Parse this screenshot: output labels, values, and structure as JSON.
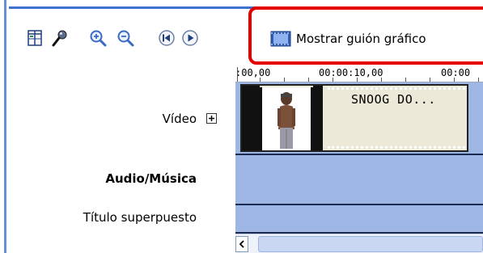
{
  "toolbar": {
    "storyboard_label": "Mostrar guión gráfico",
    "buttons": [
      "timeline-icon",
      "microphone-icon",
      "zoom-in-icon",
      "zoom-out-icon",
      "rewind-icon",
      "play-icon",
      "storyboard-icon"
    ]
  },
  "ruler": {
    "labels": [
      ":00,00",
      "00:00:10,00",
      "00:00"
    ]
  },
  "tracks": {
    "video_label": "Vídeo",
    "audio_label": "Audio/Música",
    "title_label": "Título superpuesto"
  },
  "clip": {
    "title": "SNOOG DO..."
  },
  "colors": {
    "track_bg": "#9db6e4",
    "highlight": "#e50000",
    "accent": "#3f6fd1"
  }
}
